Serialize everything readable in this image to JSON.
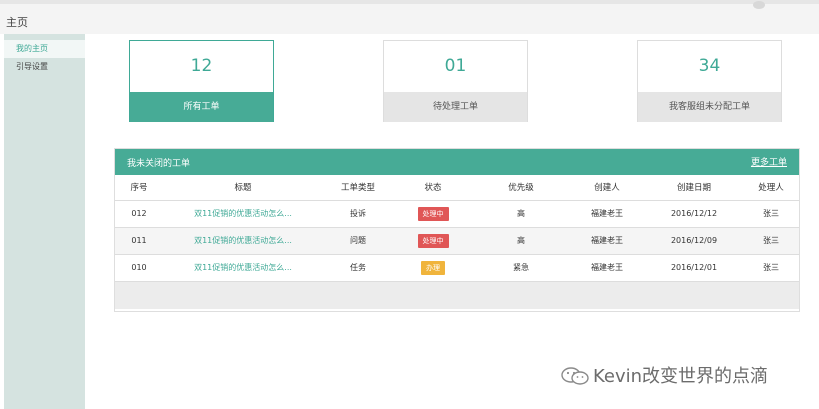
{
  "header": {
    "title": "主页"
  },
  "sidebar": {
    "items": [
      {
        "label": "我的主页"
      },
      {
        "label": "引导设置"
      }
    ]
  },
  "cards": [
    {
      "value": "12",
      "label": "所有工单"
    },
    {
      "value": "01",
      "label": "待处理工单"
    },
    {
      "value": "34",
      "label": "我客服组未分配工单"
    }
  ],
  "panel": {
    "title": "我未关闭的工单",
    "more_label": "更多工单",
    "columns": [
      "序号",
      "标题",
      "工单类型",
      "状态",
      "优先级",
      "创建人",
      "创建日期",
      "处理人"
    ],
    "rows": [
      {
        "id": "012",
        "title": "双11促销的优惠活动怎么...",
        "type": "投诉",
        "status": "处理中",
        "status_color": "#e05656",
        "priority": "高",
        "creator": "福建老王",
        "date": "2016/12/12",
        "handler": "张三"
      },
      {
        "id": "011",
        "title": "双11促销的优惠活动怎么...",
        "type": "问题",
        "status": "处理中",
        "status_color": "#e05656",
        "priority": "高",
        "creator": "福建老王",
        "date": "2016/12/09",
        "handler": "张三"
      },
      {
        "id": "010",
        "title": "双11促销的优惠活动怎么...",
        "type": "任务",
        "status": "办理",
        "status_color": "#f0b43c",
        "priority": "紧急",
        "creator": "福建老王",
        "date": "2016/12/01",
        "handler": "张三"
      }
    ]
  },
  "watermark": {
    "text": "Kevin改变世界的点滴"
  }
}
